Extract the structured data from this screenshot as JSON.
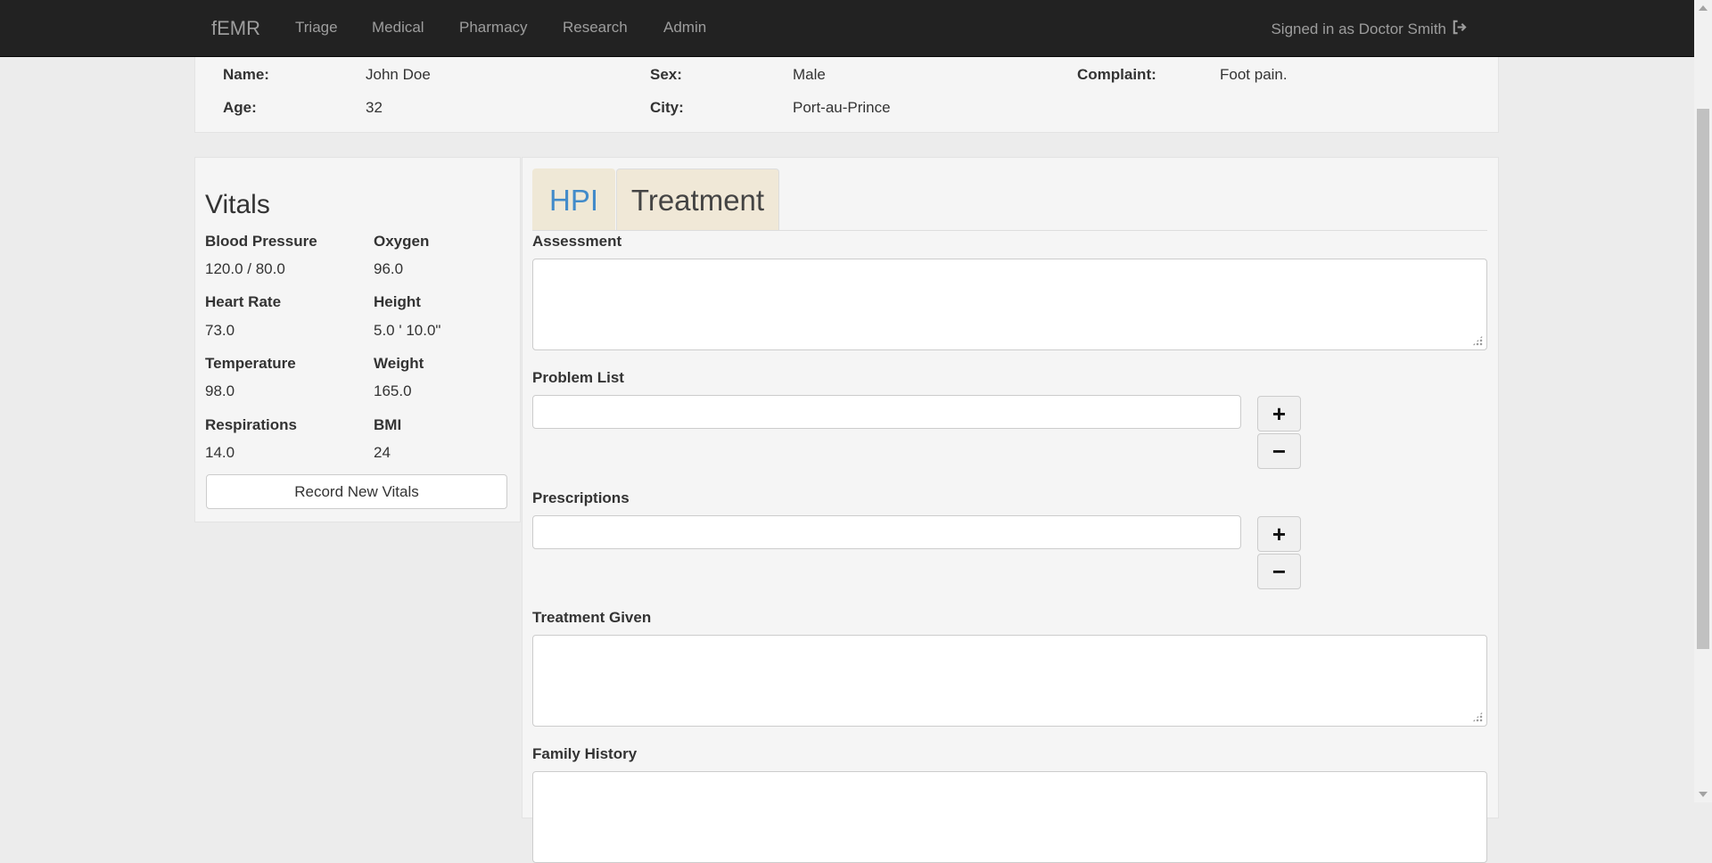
{
  "nav": {
    "brand": "fEMR",
    "links": [
      "Triage",
      "Medical",
      "Pharmacy",
      "Research",
      "Admin"
    ],
    "signed_in": "Signed in as Doctor Smith",
    "signout_icon": "sign-out-icon"
  },
  "patient": {
    "name_label": "Name:",
    "name": "John Doe",
    "age_label": "Age:",
    "age": "32",
    "sex_label": "Sex:",
    "sex": "Male",
    "city_label": "City:",
    "city": "Port-au-Prince",
    "complaint_label": "Complaint:",
    "complaint": "Foot pain."
  },
  "vitals": {
    "title": "Vitals",
    "items": [
      {
        "label": "Blood Pressure",
        "value": "120.0 / 80.0"
      },
      {
        "label": "Oxygen",
        "value": "96.0"
      },
      {
        "label": "Heart Rate",
        "value": "73.0"
      },
      {
        "label": "Height",
        "value": "5.0 ' 10.0\""
      },
      {
        "label": "Temperature",
        "value": "98.0"
      },
      {
        "label": "Weight",
        "value": "165.0"
      },
      {
        "label": "Respirations",
        "value": "14.0"
      },
      {
        "label": "BMI",
        "value": "24"
      }
    ],
    "record_button": "Record New Vitals"
  },
  "tabs": {
    "hpi": "HPI",
    "treatment": "Treatment",
    "active": "Treatment"
  },
  "treatment": {
    "assessment_label": "Assessment",
    "assessment_value": "",
    "problem_list_label": "Problem List",
    "problem_value": "",
    "prescriptions_label": "Prescriptions",
    "prescription_value": "",
    "treatment_given_label": "Treatment Given",
    "treatment_given_value": "",
    "family_history_label": "Family History",
    "family_history_value": "",
    "add_symbol": "+",
    "remove_symbol": "−"
  },
  "colors": {
    "navbar_bg": "#222222",
    "nav_text": "#9d9d9d",
    "tab_bg": "#efe8d6",
    "hpi_link": "#428bca"
  }
}
